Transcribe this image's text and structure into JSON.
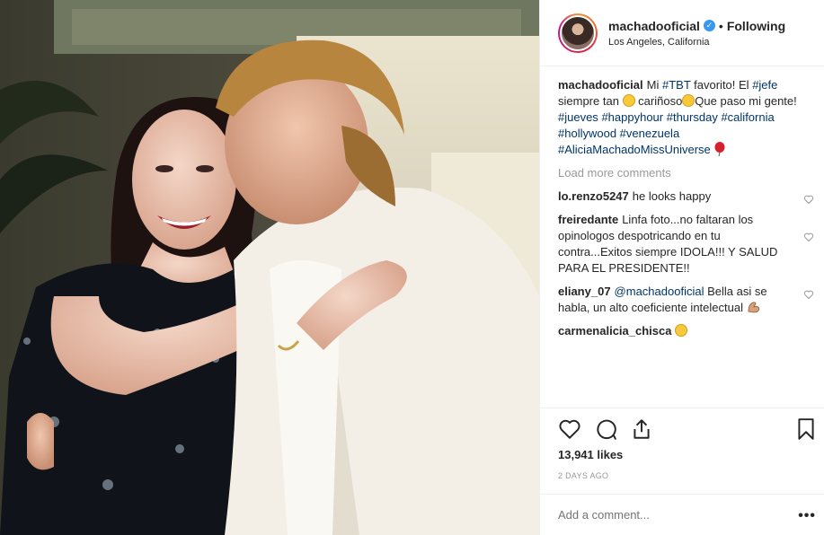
{
  "header": {
    "username": "machadooficial",
    "verified_icon": "verified-badge-icon",
    "separator": "•",
    "follow_status": "Following",
    "location": "Los Angeles, California"
  },
  "caption": {
    "username": "machadooficial",
    "text_1": "Mi ",
    "tag_tbt": "#TBT",
    "text_2": " favorito! El ",
    "tag_jefe": "#jefe",
    "text_3": " siempre tan ",
    "text_4": " cariñoso",
    "text_5": "Que paso mi gente! ",
    "tag_jueves": "#jueves",
    "tag_happyhour": "#happyhour",
    "tag_thursday": "#thursday",
    "tag_california": "#california",
    "tag_hollywood": "#hollywood",
    "tag_venezuela": "#venezuela",
    "tag_alicia": "#AliciaMachadoMissUniverse"
  },
  "load_more": "Load more comments",
  "comments": [
    {
      "username": "lo.renzo5247",
      "text": "he looks happy"
    },
    {
      "username": "freiredante",
      "text": "Linfa foto...no faltaran los opinologos despotricando en tu contra...Exitos siempre IDOLA!!! Y SALUD PARA EL PRESIDENTE!!"
    },
    {
      "username": "eliany_07",
      "mention": "@machadooficial",
      "text": " Bella asi se habla, un alto coeficiente intelectual "
    },
    {
      "username": "carmenalicia_chisca",
      "text": ""
    }
  ],
  "likes": "13,941 likes",
  "date": "2 DAYS AGO",
  "add_comment_placeholder": "Add a comment...",
  "more_options": "•••",
  "colors": {
    "link": "#003569",
    "verified": "#3897f0",
    "muted": "#999999",
    "text": "#262626"
  }
}
